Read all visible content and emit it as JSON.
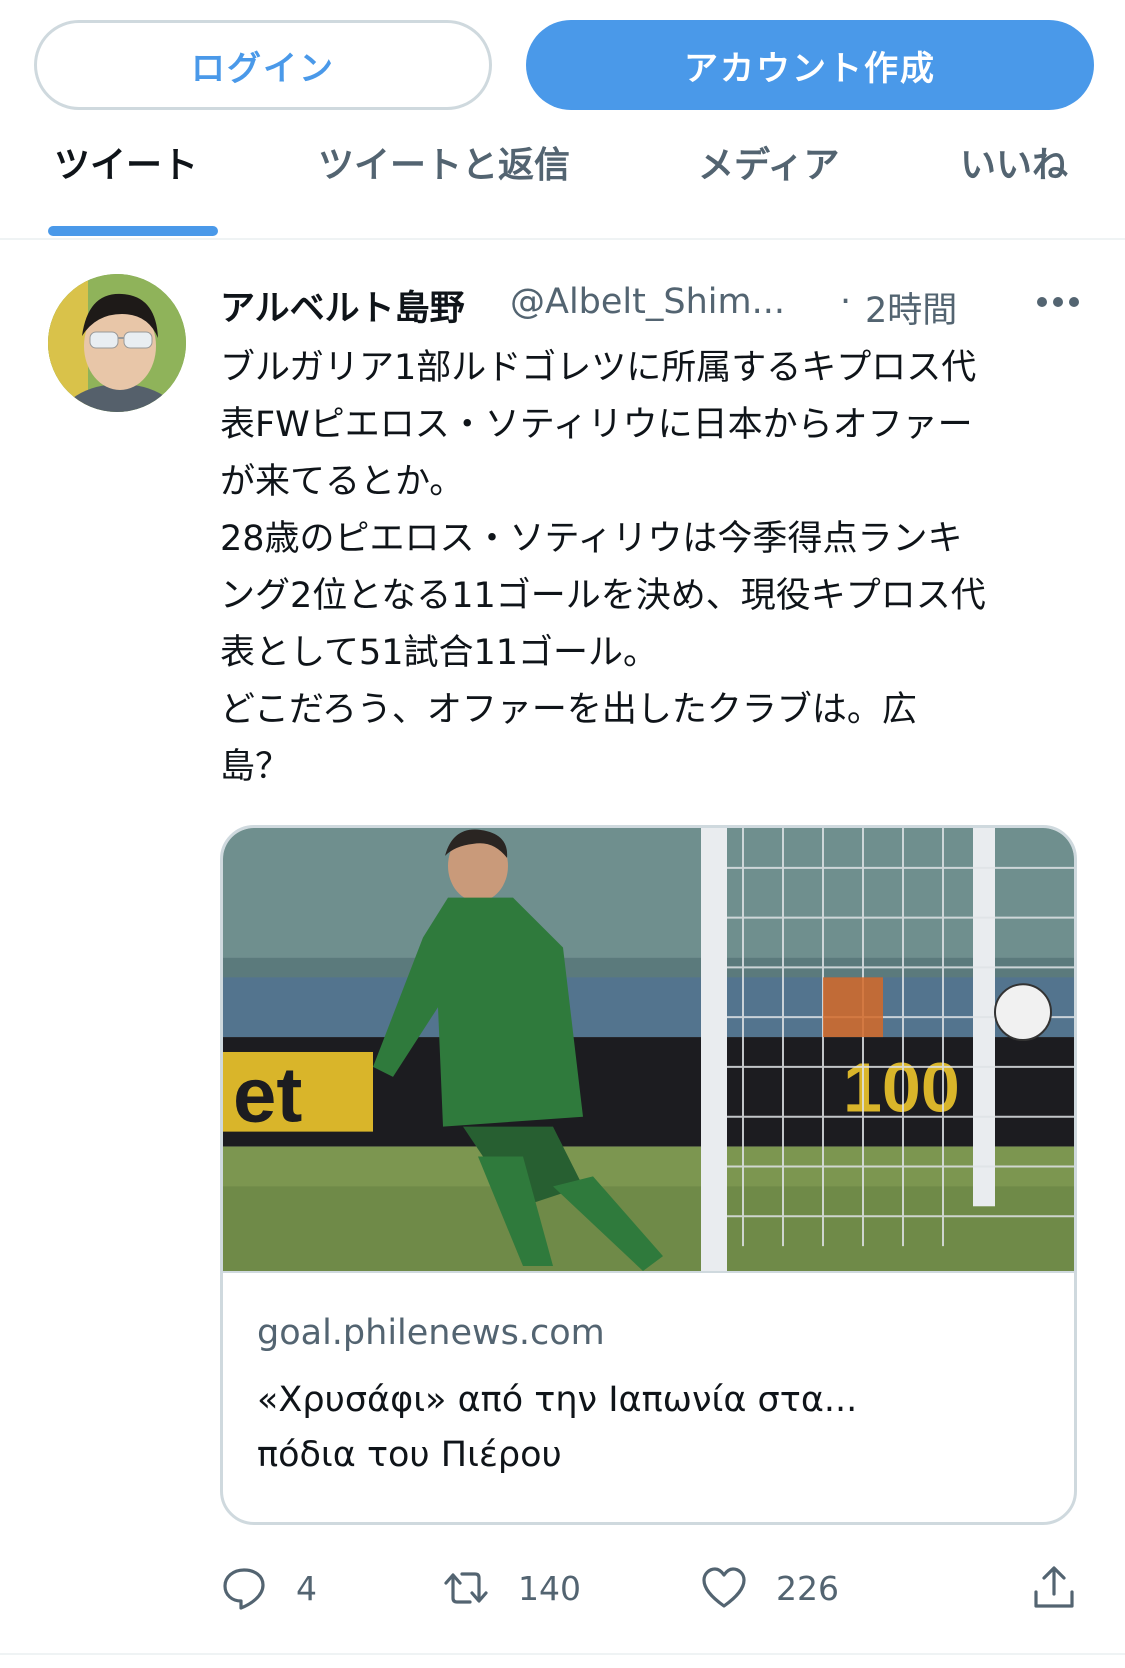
{
  "auth": {
    "login_label": "ログイン",
    "signup_label": "アカウント作成"
  },
  "tabs": [
    {
      "label": "ツイート",
      "active": true
    },
    {
      "label": "ツイートと返信",
      "active": false
    },
    {
      "label": "メディア",
      "active": false
    },
    {
      "label": "いいね",
      "active": false
    }
  ],
  "tweet": {
    "display_name": "アルベルト島野",
    "handle": "@Albelt_Shim...",
    "separator": "·",
    "time": "2時間",
    "text_lines": [
      "ブルガリア1部ルドゴレツに所属するキプロス代",
      "表FWピエロス・ソティリウに日本からオファー",
      "が来てるとか。",
      "28歳のピエロス・ソティリウは今季得点ランキ",
      "ング2位となる11ゴールを決め、現役キプロス代",
      "表として51試合11ゴール。",
      "どこだろう、オファーを出したクラブは。広",
      "島？"
    ],
    "card": {
      "domain": "goal.philenews.com",
      "title_line1": "«Χρυσάφι» από την Ιαπωνία στα...",
      "title_line2": "πόδια του Πιέρου"
    },
    "actions": {
      "replies": "4",
      "retweets": "140",
      "likes": "226"
    }
  },
  "icons": {
    "more": "more-icon",
    "reply": "reply-icon",
    "retweet": "retweet-icon",
    "like": "heart-icon",
    "share": "share-icon"
  },
  "colors": {
    "accent": "#4a99e9",
    "text_primary": "#0f1419",
    "text_secondary": "#536471",
    "border": "#cfd9de"
  }
}
